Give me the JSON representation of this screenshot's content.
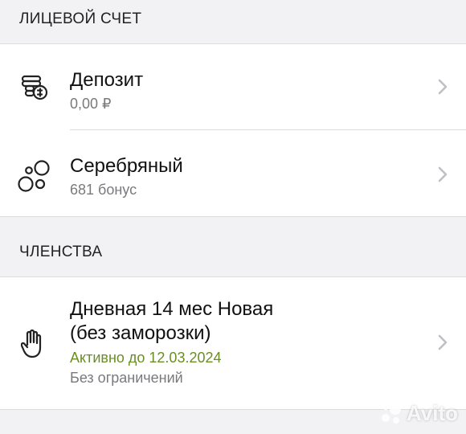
{
  "sections": {
    "account_header": "ЛИЦЕВОЙ СЧЕТ",
    "membership_header": "ЧЛЕНСТВА"
  },
  "account_items": [
    {
      "title": "Депозит",
      "subtitle": "0,00 ₽",
      "icon": "coin-stack-icon"
    },
    {
      "title": "Серебряный",
      "subtitle": "681 бонус",
      "icon": "bubbles-icon"
    }
  ],
  "membership": {
    "title_line1": "Дневная 14 мес Новая",
    "title_line2": "(без заморозки)",
    "status": "Активно до 12.03.2024",
    "limit": "Без ограничений",
    "icon": "hand-icon"
  },
  "colors": {
    "background": "#f2f2f4",
    "card": "#ffffff",
    "status_green": "#6b8e23",
    "subtitle_gray": "#7a7a7e",
    "chevron": "#bfbfc4"
  },
  "watermark": {
    "text": "Avito"
  }
}
